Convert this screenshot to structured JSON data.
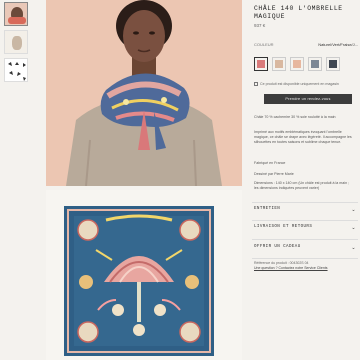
{
  "product": {
    "title": "CHÂLE 140 L'OMBRELLE MAGIQUE",
    "price": "937 €",
    "color_label": "COULEUR",
    "color_value": "Naturel/Vert/Fraise/J...",
    "swatches": [
      {
        "name": "rose",
        "color": "#d97a7a",
        "selected": true
      },
      {
        "name": "beige",
        "color": "#d9b8a0",
        "selected": false
      },
      {
        "name": "peach",
        "color": "#e7b79f",
        "selected": false
      },
      {
        "name": "grey-blue",
        "color": "#7c8795",
        "selected": false
      },
      {
        "name": "dark",
        "color": "#3f4752",
        "selected": false
      }
    ],
    "gift_check": "Ce produit est disponible uniquement en magasin",
    "cta": "Prendre un rendez-vous",
    "desc1": "Châle 70 % cachemire 30 % soie roulotté à la main",
    "desc2": "Imprimé aux motifs emblématiques évoquant l'ombrelle magique, ce châle se drape avec légèreté. Il accompagne les silhouettes en toutes saisons et sublime chaque tenue.",
    "desc3": "Fabriqué en France",
    "desc4": "Dessiné par Pierre Marie",
    "desc5": "Dimensions : 140 x 140 cm (Un châle est produit à la main ; les dimensions indiquées peuvent varier)",
    "accordion": [
      "ENTRETIEN",
      "LIVRAISON ET RETOURS",
      "OFFRIR UN CADEAU"
    ],
    "reference": "Référence du produit : 004302S 04",
    "contact": "Une question ? Contactez notre Service Clients"
  }
}
